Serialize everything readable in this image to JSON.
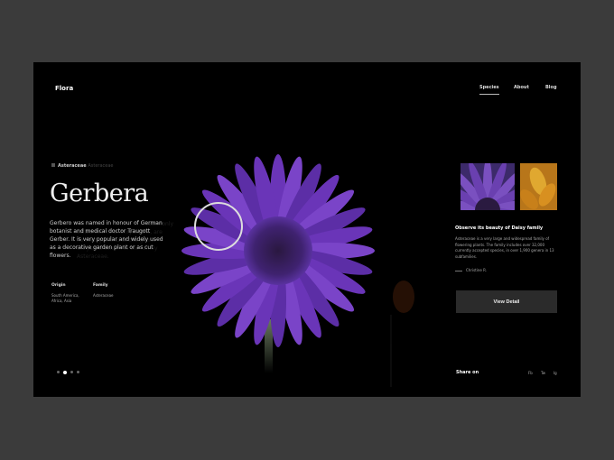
{
  "brand": "Flora",
  "nav": [
    {
      "label": "Species",
      "active": true
    },
    {
      "label": "About"
    },
    {
      "label": "Blog"
    }
  ],
  "category": {
    "name": "Asteraceae",
    "sub": "Asteraceae"
  },
  "title": "Gerbera",
  "description": "Gerbero was named in honour of German botanist and medical doctor Traugott Gerber. It is very popular and widely used as a decorative garden plant or as cut flowers.",
  "ghost_text": "...commonly called mums or chrysanths, are flowering plants of the genus Chrysanthemum in the family Asteraceae.",
  "origin": {
    "label": "Origin",
    "value": "South America, Africa, Asia"
  },
  "family": {
    "label": "Family",
    "value": "Asteraceae"
  },
  "slides": {
    "count": 4,
    "active": 1
  },
  "side": {
    "heading": "Observe its beauty of Daisy family",
    "text": "Asteraceae is a very large and widespread family of flowering plants. The family includes over 32,000 currently accepted species, in over 1,900 genera in 13 subfamilies.",
    "quote": "Christine R.",
    "button": "View Detail"
  },
  "share": {
    "label": "Share on",
    "links": [
      "Fb",
      "Tw",
      "Ig"
    ]
  },
  "colors": {
    "petal": "#6a35b8",
    "accent": "#ffffff"
  }
}
